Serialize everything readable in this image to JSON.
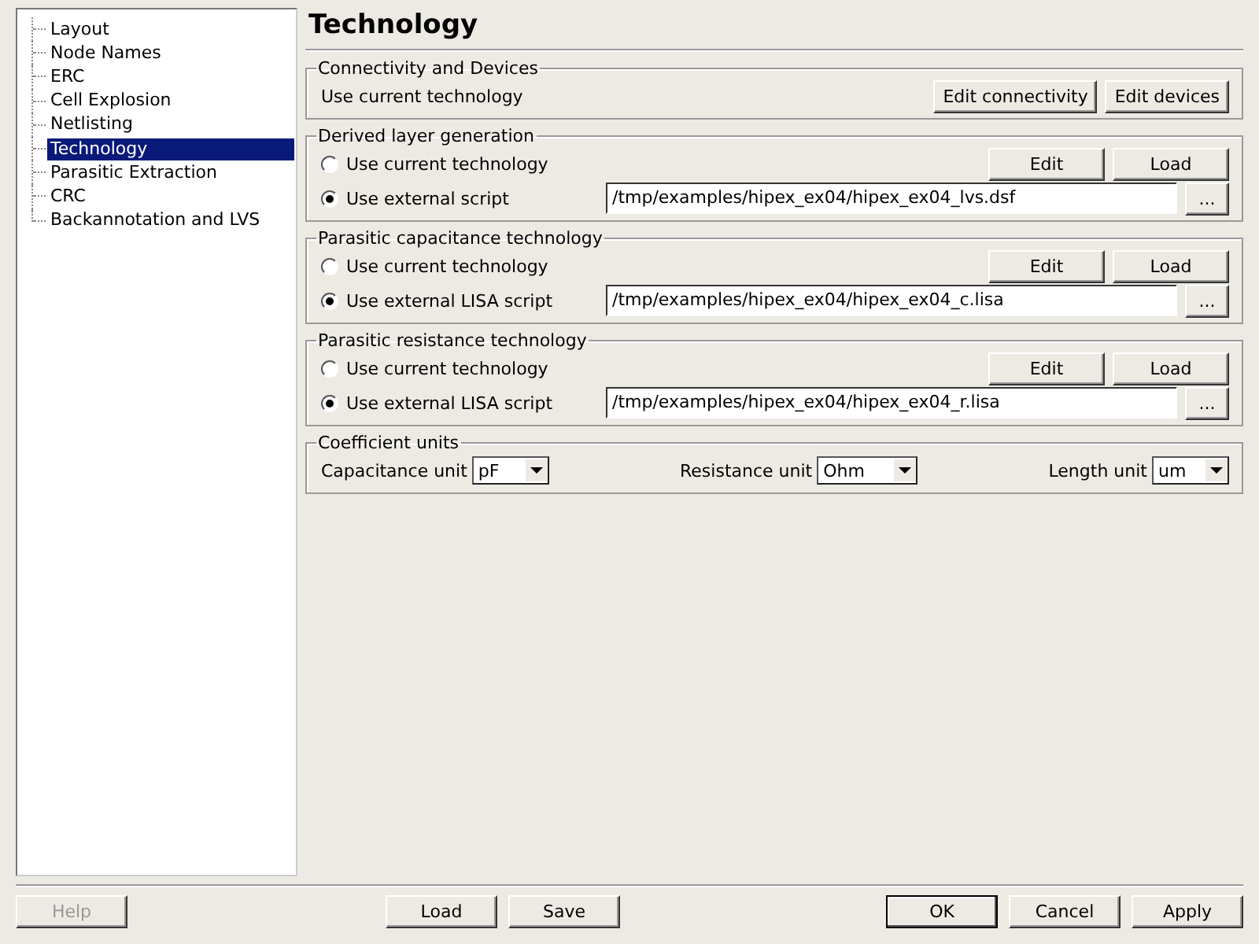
{
  "sidebar": {
    "items": [
      {
        "label": "Layout",
        "selected": false
      },
      {
        "label": "Node Names",
        "selected": false
      },
      {
        "label": "ERC",
        "selected": false
      },
      {
        "label": "Cell Explosion",
        "selected": false
      },
      {
        "label": "Netlisting",
        "selected": false
      },
      {
        "label": "Technology",
        "selected": true
      },
      {
        "label": "Parasitic Extraction",
        "selected": false
      },
      {
        "label": "CRC",
        "selected": false
      },
      {
        "label": "Backannotation and LVS",
        "selected": false
      }
    ]
  },
  "page_title": "Technology",
  "groups": [
    {
      "kind": "info",
      "title": "Connectivity and Devices",
      "text": "Use current technology",
      "buttons": [
        "Edit connectivity",
        "Edit devices"
      ]
    },
    {
      "kind": "tech",
      "title": "Derived layer generation",
      "options": [
        {
          "label": "Use current technology",
          "selected": false
        },
        {
          "label": "Use external script",
          "selected": true
        }
      ],
      "buttons": [
        "Edit",
        "Load"
      ],
      "path": "/tmp/examples/hipex_ex04/hipex_ex04_lvs.dsf",
      "browse": "..."
    },
    {
      "kind": "tech",
      "title": "Parasitic capacitance technology",
      "options": [
        {
          "label": "Use current technology",
          "selected": false
        },
        {
          "label": "Use external LISA script",
          "selected": true
        }
      ],
      "buttons": [
        "Edit",
        "Load"
      ],
      "path": "/tmp/examples/hipex_ex04/hipex_ex04_c.lisa",
      "browse": "..."
    },
    {
      "kind": "tech",
      "title": "Parasitic resistance technology",
      "options": [
        {
          "label": "Use current technology",
          "selected": false
        },
        {
          "label": "Use external LISA script",
          "selected": true
        }
      ],
      "buttons": [
        "Edit",
        "Load"
      ],
      "path": "/tmp/examples/hipex_ex04/hipex_ex04_r.lisa",
      "browse": "..."
    },
    {
      "kind": "units",
      "title": "Coefficient units",
      "units": [
        {
          "label": "Capacitance unit",
          "value": "pF"
        },
        {
          "label": "Resistance unit",
          "value": "Ohm"
        },
        {
          "label": "Length unit",
          "value": "um"
        }
      ]
    }
  ],
  "footer": {
    "left": [
      {
        "label": "Help",
        "disabled": true,
        "default": false
      }
    ],
    "middle": [
      {
        "label": "Load",
        "disabled": false,
        "default": false
      },
      {
        "label": "Save",
        "disabled": false,
        "default": false
      }
    ],
    "right": [
      {
        "label": "OK",
        "disabled": false,
        "default": true
      },
      {
        "label": "Cancel",
        "disabled": false,
        "default": false
      },
      {
        "label": "Apply",
        "disabled": false,
        "default": false
      }
    ]
  }
}
